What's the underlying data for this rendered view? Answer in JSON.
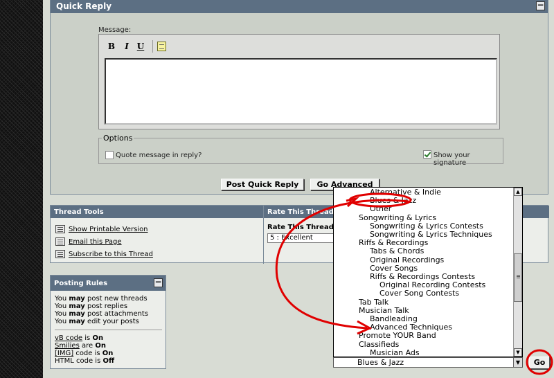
{
  "quick_reply": {
    "title": "Quick Reply",
    "collapse_glyph": "−",
    "message_label": "Message:",
    "toolbar": {
      "bold": "B",
      "italic": "I",
      "underline": "U"
    },
    "options": {
      "legend": "Options",
      "quote_label": "Quote message in reply?",
      "signature_label": "Show your signature"
    },
    "post_button": "Post Quick Reply",
    "advanced_button": "Go Advanced"
  },
  "thread_tools": {
    "title": "Thread Tools",
    "items": [
      "Show Printable Version",
      "Email this Page",
      "Subscribe to this Thread"
    ]
  },
  "rate_thread": {
    "title": "Rate This Thread",
    "label": "Rate This Thread:",
    "selected": "5 : Excellent"
  },
  "posting_rules": {
    "title": "Posting Rules",
    "collapse_glyph": "−",
    "lines": [
      {
        "pre": "You ",
        "bold": "may",
        "post": " post new threads"
      },
      {
        "pre": "You ",
        "bold": "may",
        "post": " post replies"
      },
      {
        "pre": "You ",
        "bold": "may",
        "post": " post attachments"
      },
      {
        "pre": "You ",
        "bold": "may",
        "post": " edit your posts"
      }
    ],
    "codes": [
      {
        "name": "vB code",
        "mid": " is ",
        "state": "On"
      },
      {
        "name": "Smilies",
        "mid": " are ",
        "state": "On"
      },
      {
        "name": "[IMG]",
        "mid": " code is ",
        "state": "On"
      },
      {
        "name": "HTML code",
        "mid": " is ",
        "state": "Off"
      }
    ]
  },
  "forum_jump": {
    "options": [
      {
        "label": "Alternative & Indie",
        "level": 1
      },
      {
        "label": "Blues & Jazz",
        "level": 1
      },
      {
        "label": "Other",
        "level": 1
      },
      {
        "label": "Songwriting & Lyrics",
        "level": 0
      },
      {
        "label": "Songwriting & Lyrics Contests",
        "level": 1
      },
      {
        "label": "Songwriting & Lyrics Techniques",
        "level": 1
      },
      {
        "label": "Riffs & Recordings",
        "level": 0
      },
      {
        "label": "Tabs & Chords",
        "level": 1
      },
      {
        "label": "Original Recordings",
        "level": 1
      },
      {
        "label": "Cover Songs",
        "level": 1
      },
      {
        "label": "Riffs & Recordings Contests",
        "level": 1
      },
      {
        "label": "Original Recording Contests",
        "level": 2
      },
      {
        "label": "Cover Song Contests",
        "level": 2
      },
      {
        "label": "Tab Talk",
        "level": 0
      },
      {
        "label": "Musician Talk",
        "level": 0
      },
      {
        "label": "Bandleading",
        "level": 1
      },
      {
        "label": "Advanced Techniques",
        "level": 1
      },
      {
        "label": "Promote YOUR Band",
        "level": 0
      },
      {
        "label": "Classifieds",
        "level": 0
      },
      {
        "label": "Musician Ads",
        "level": 1
      }
    ],
    "selected": "Blues & Jazz",
    "go_button": "Go"
  },
  "colors": {
    "header_bg": "#5c6f83",
    "annotation": "#e00000"
  }
}
